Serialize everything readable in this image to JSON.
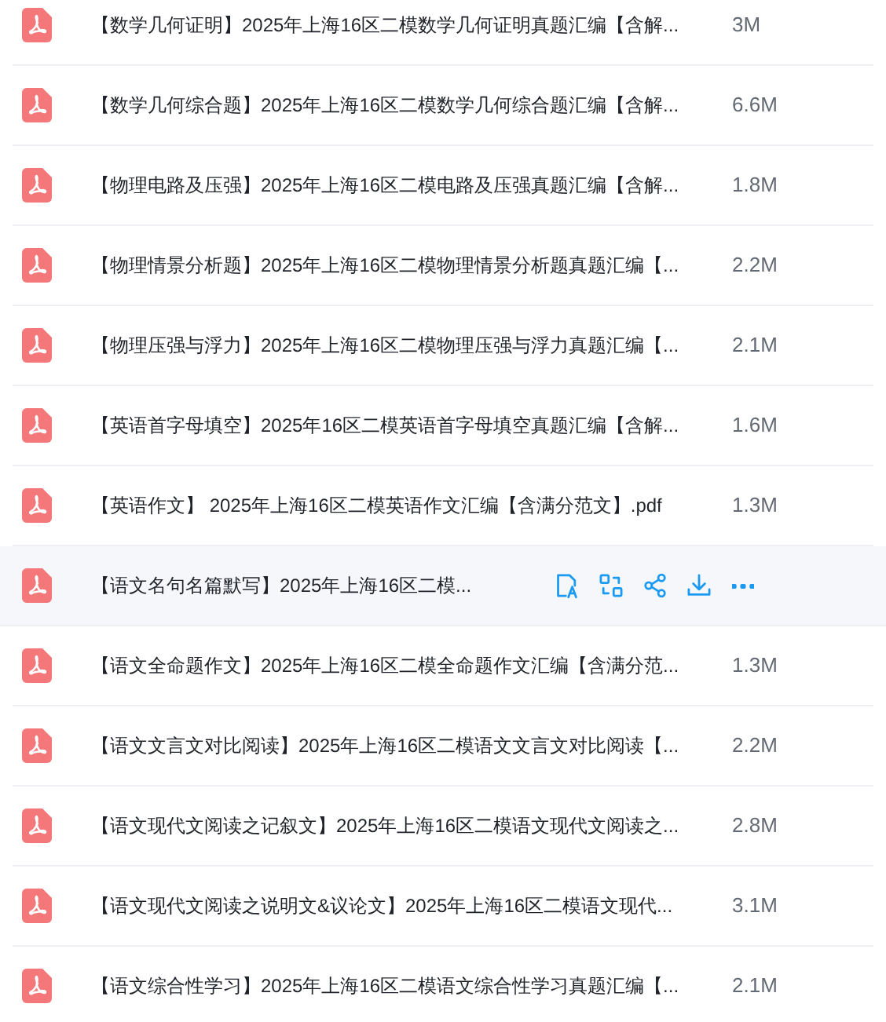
{
  "files": [
    {
      "name": "【数学几何证明】2025年上海16区二模数学几何证明真题汇编【含解...",
      "size": "3M",
      "hovered": false
    },
    {
      "name": "【数学几何综合题】2025年上海16区二模数学几何综合题汇编【含解...",
      "size": "6.6M",
      "hovered": false
    },
    {
      "name": "【物理电路及压强】2025年上海16区二模电路及压强真题汇编【含解...",
      "size": "1.8M",
      "hovered": false
    },
    {
      "name": "【物理情景分析题】2025年上海16区二模物理情景分析题真题汇编【...",
      "size": "2.2M",
      "hovered": false
    },
    {
      "name": "【物理压强与浮力】2025年上海16区二模物理压强与浮力真题汇编【...",
      "size": "2.1M",
      "hovered": false
    },
    {
      "name": "【英语首字母填空】2025年16区二模英语首字母填空真题汇编【含解...",
      "size": "1.6M",
      "hovered": false
    },
    {
      "name": "【英语作文】 2025年上海16区二模英语作文汇编【含满分范文】.pdf",
      "size": "1.3M",
      "hovered": false
    },
    {
      "name": "【语文名句名篇默写】2025年上海16区二模...",
      "hovered": true
    },
    {
      "name": "【语文全命题作文】2025年上海16区二模全命题作文汇编【含满分范...",
      "size": "1.3M",
      "hovered": false
    },
    {
      "name": "【语文文言文对比阅读】2025年上海16区二模语文文言文对比阅读【...",
      "size": "2.2M",
      "hovered": false
    },
    {
      "name": "【语文现代文阅读之记叙文】2025年上海16区二模语文现代文阅读之...",
      "size": "2.8M",
      "hovered": false
    },
    {
      "name": "【语文现代文阅读之说明文&议论文】2025年上海16区二模语文现代...",
      "size": "3.1M",
      "hovered": false
    },
    {
      "name": "【语文综合性学习】2025年上海16区二模语文综合性学习真题汇编【...",
      "size": "2.1M",
      "hovered": false
    }
  ]
}
